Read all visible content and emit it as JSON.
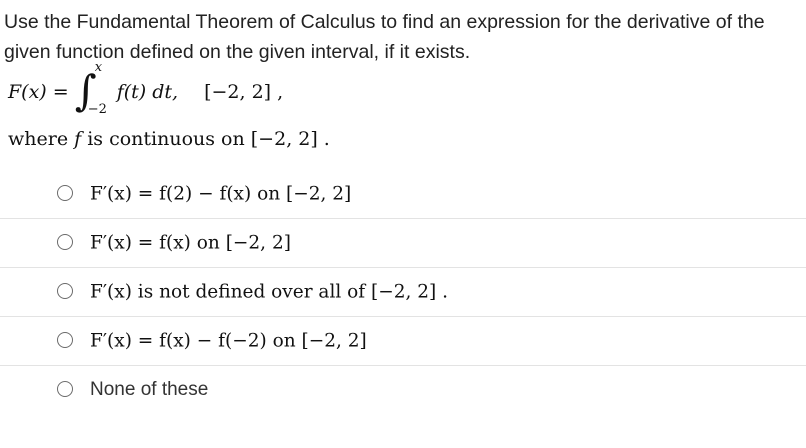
{
  "question": {
    "prompt": "Use the Fundamental Theorem of Calculus to find an expression for the derivative of the given function defined on the given interval, if it exists.",
    "lhs": "F(x) =",
    "integral_sign": "∫",
    "integral_upper": "x",
    "integral_lower": "−2",
    "integrand": "f(t) dt,",
    "interval": "[−2, 2] ,",
    "where_prefix": "where",
    "where_var": "f",
    "where_suffix": "is continuous on [−2, 2] ."
  },
  "options": [
    {
      "text": "F′(x) = f(2) − f(x) on [−2, 2]",
      "selected": false
    },
    {
      "text": "F′(x) = f(x) on [−2, 2]",
      "selected": false
    },
    {
      "text": "F′(x) is not defined over all of [−2, 2] .",
      "selected": false
    },
    {
      "text": "F′(x) = f(x) − f(−2) on [−2, 2]",
      "selected": false
    },
    {
      "text": "None of these",
      "selected": false
    }
  ],
  "colors": {
    "text": "#222222",
    "radio_border": "#6b6b6b",
    "divider": "#e3e3e3"
  }
}
